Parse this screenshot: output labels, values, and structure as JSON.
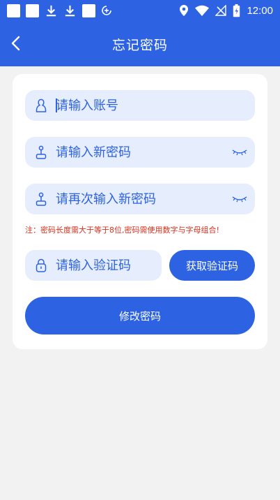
{
  "status_bar": {
    "time": "12:00",
    "left_icons": [
      "notification-square-icon",
      "notification-square-icon",
      "download-icon",
      "download-icon",
      "notification-square-icon",
      "data-saver-icon"
    ],
    "right_icons": [
      "location-icon",
      "wifi-icon",
      "no-signal-icon",
      "battery-charging-icon"
    ]
  },
  "header": {
    "title": "忘记密码",
    "back_icon": "chevron-left-icon"
  },
  "form": {
    "account": {
      "placeholder": "请输入账号",
      "value": "",
      "icon": "user-icon"
    },
    "new_password": {
      "placeholder": "请输入新密码",
      "value": "",
      "icon": "lock-key-icon",
      "toggle_icon": "eye-closed-icon"
    },
    "confirm_password": {
      "placeholder": "请再次输入新密码",
      "value": "",
      "icon": "lock-key-icon",
      "toggle_icon": "eye-closed-icon"
    },
    "note": "注：密码长度需大于等于8位,密码需使用数字与字母组合!",
    "code": {
      "placeholder": "请输入验证码",
      "value": "",
      "icon": "padlock-icon"
    },
    "get_code_label": "获取验证码",
    "submit_label": "修改密码"
  },
  "colors": {
    "primary": "#2d63e2",
    "field_bg": "#e6edfc",
    "page_bg": "#f2f2f2",
    "note_text": "#d9301c"
  }
}
